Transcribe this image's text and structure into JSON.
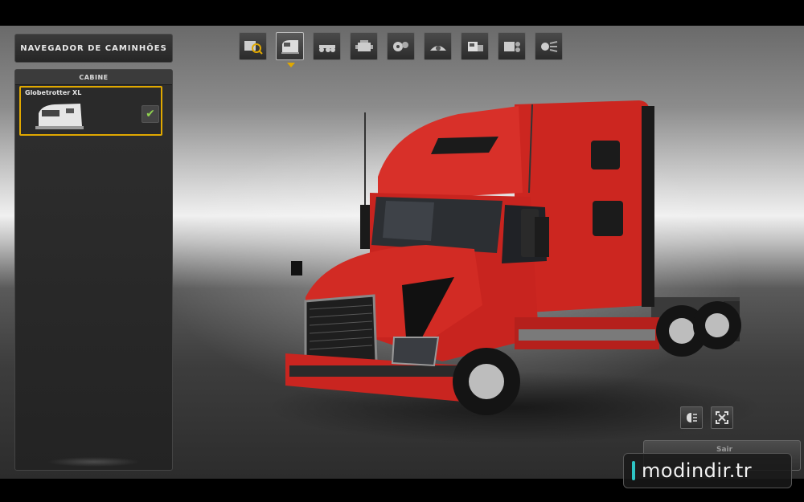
{
  "sidebar": {
    "title": "NAVEGADOR DE CAMINHÕES",
    "section_header": "CABINE",
    "cabins": [
      {
        "name": "Globetrotter XL",
        "selected": true
      }
    ]
  },
  "toolbar": {
    "categories": [
      {
        "icon": "truck-browser-icon",
        "active": false
      },
      {
        "icon": "cabin-icon",
        "active": true
      },
      {
        "icon": "chassis-icon",
        "active": false
      },
      {
        "icon": "engine-icon",
        "active": false
      },
      {
        "icon": "transmission-icon",
        "active": false
      },
      {
        "icon": "interior-icon",
        "active": false
      },
      {
        "icon": "paint-icon",
        "active": false
      },
      {
        "icon": "accessories-icon",
        "active": false
      },
      {
        "icon": "lights-icon",
        "active": false
      }
    ]
  },
  "controls": {
    "exit_label": "Sair",
    "view_buttons": [
      "headlight-toggle-icon",
      "fullscreen-icon"
    ]
  },
  "watermark": {
    "text": "modindir.tr"
  },
  "colors": {
    "accent": "#e0a800",
    "truck_body": "#d42a25",
    "check": "#8fd14f"
  }
}
